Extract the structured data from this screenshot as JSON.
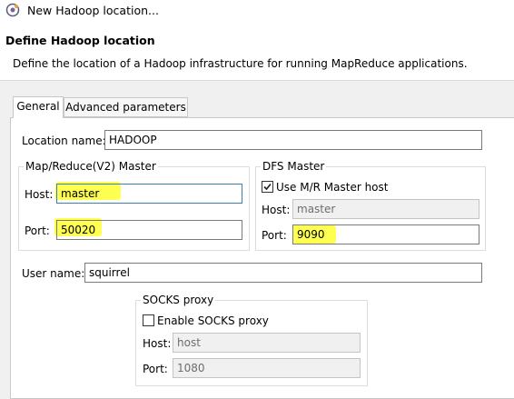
{
  "window": {
    "title": "New Hadoop location..."
  },
  "header": {
    "title": "Define Hadoop location",
    "description": "Define the location of a Hadoop infrastructure for running MapReduce applications."
  },
  "tabs": [
    {
      "label": "General",
      "active": true
    },
    {
      "label": "Advanced parameters",
      "active": false
    }
  ],
  "general": {
    "location_name_label": "Location name:",
    "location_name": "HADOOP",
    "mapreduce": {
      "title": "Map/Reduce(V2) Master",
      "host_label": "Host:",
      "host": "master",
      "port_label": "Port:",
      "port": "50020"
    },
    "dfs": {
      "title": "DFS Master",
      "use_mr_host_label": "Use M/R Master host",
      "use_mr_host_checked": true,
      "host_label": "Host:",
      "host": "master",
      "port_label": "Port:",
      "port": "9090"
    },
    "user_name_label": "User name:",
    "user_name": "squirrel",
    "socks": {
      "title": "SOCKS proxy",
      "enable_label": "Enable SOCKS proxy",
      "enable_checked": false,
      "host_label": "Host:",
      "host": "host",
      "port_label": "Port:",
      "port": "1080"
    }
  },
  "colors": {
    "highlight": "#ffff33",
    "focus_border": "#3c7fb1"
  }
}
